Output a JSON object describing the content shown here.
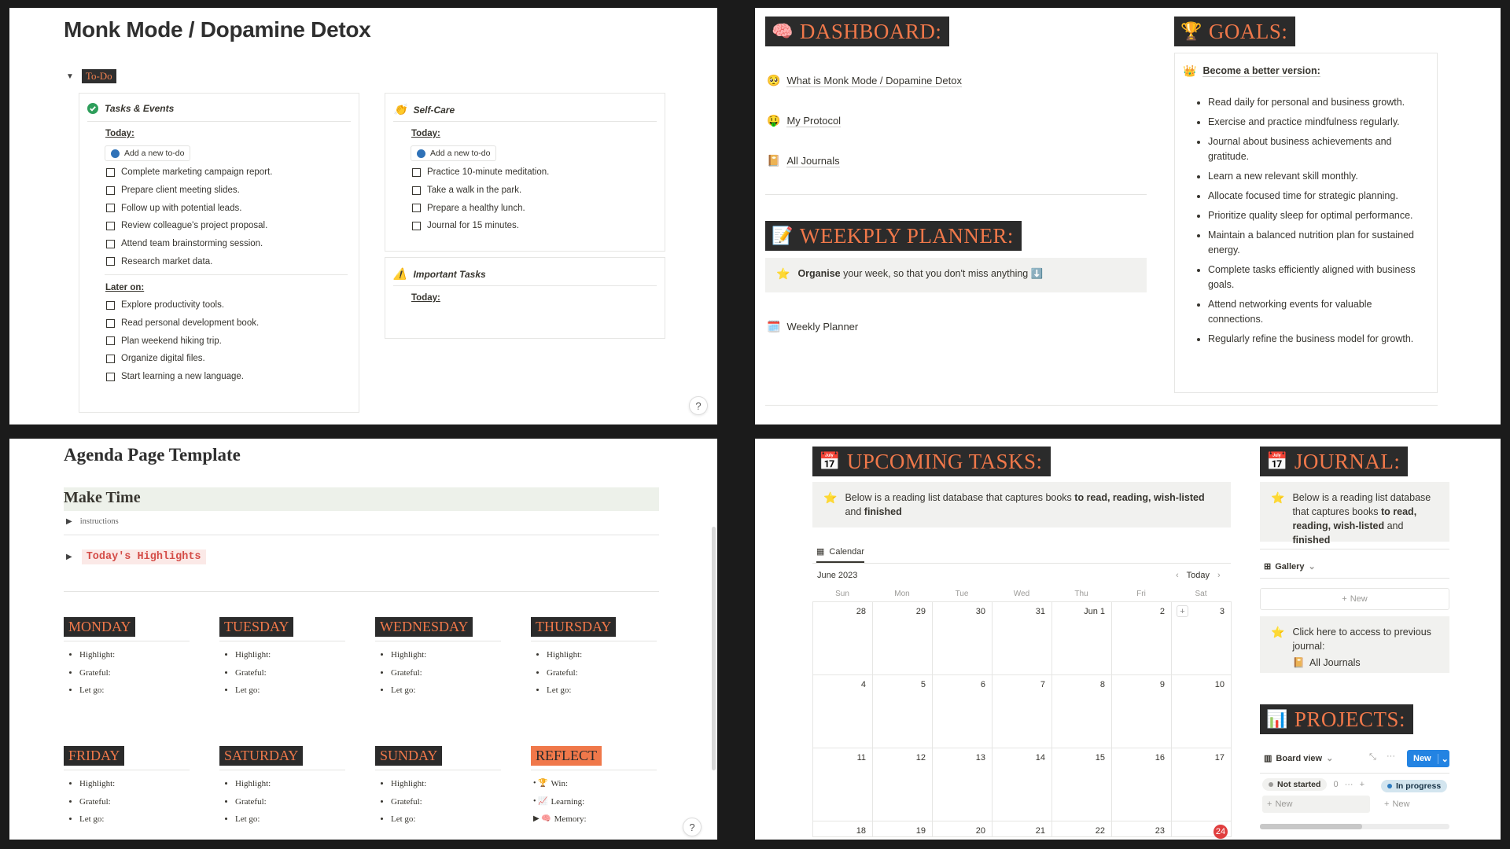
{
  "monk": {
    "title": "Monk Mode / Dopamine Detox",
    "todo_tag": "To-Do",
    "tasks_card": {
      "title": "Tasks & Events",
      "today_label": "Today:",
      "add_label": "Add a new to-do",
      "today_items": [
        "Complete marketing campaign report.",
        "Prepare client meeting slides.",
        "Follow up with potential leads.",
        "Review colleague's project proposal.",
        "Attend team brainstorming session.",
        "Research market data."
      ],
      "later_label": "Later on:",
      "later_items": [
        "Explore productivity tools.",
        "Read personal development book.",
        "Plan weekend hiking trip.",
        "Organize digital files.",
        "Start learning a new language."
      ]
    },
    "selfcare_card": {
      "title": "Self-Care",
      "today_label": "Today:",
      "add_label": "Add a new to-do",
      "items": [
        "Practice 10-minute meditation.",
        "Take a walk in the park.",
        "Prepare a healthy lunch.",
        "Journal for 15 minutes."
      ]
    },
    "important_card": {
      "title": "Important Tasks",
      "today_label": "Today:"
    },
    "help": "?"
  },
  "dashboard": {
    "banner": "DASHBOARD:",
    "links": [
      "What is Monk Mode / Dopamine Detox",
      "My Protocol",
      "All Journals"
    ],
    "planner_banner": "WEEKPLY PLANNER:",
    "planner_callout_bold": "Organise",
    "planner_callout_rest": " your week, so that you don't miss anything",
    "planner_link": "Weekly Planner",
    "goals_banner": "GOALS:",
    "goals_heading": "Become a better version:",
    "goals": [
      "Read daily for personal and business growth.",
      "Exercise and practice mindfulness regularly.",
      "Journal about business achievements and gratitude.",
      "Learn a new relevant skill monthly.",
      "Allocate focused time for strategic planning.",
      "Prioritize quality sleep for optimal performance.",
      "Maintain a balanced nutrition plan for sustained energy.",
      "Complete tasks efficiently aligned with business goals.",
      "Attend networking events for valuable connections.",
      "Regularly refine the business model for growth."
    ]
  },
  "agenda": {
    "title": "Agenda Page Template",
    "make_time": "Make Time",
    "instructions": "instructions",
    "highlights": "Today's Highlights",
    "days": [
      {
        "name": "MONDAY",
        "items": [
          "Highlight:",
          "Grateful:",
          "Let go:"
        ]
      },
      {
        "name": "TUESDAY",
        "items": [
          "Highlight:",
          "Grateful:",
          "Let go:"
        ]
      },
      {
        "name": "WEDNESDAY",
        "items": [
          "Highlight:",
          "Grateful:",
          "Let go:"
        ]
      },
      {
        "name": "THURSDAY",
        "items": [
          "Highlight:",
          "Grateful:",
          "Let go:"
        ]
      },
      {
        "name": "FRIDAY",
        "items": [
          "Highlight:",
          "Grateful:",
          "Let go:"
        ]
      },
      {
        "name": "SATURDAY",
        "items": [
          "Highlight:",
          "Grateful:",
          "Let go:"
        ]
      },
      {
        "name": "SUNDAY",
        "items": [
          "Highlight:",
          "Grateful:",
          "Let go:"
        ]
      }
    ],
    "reflect": {
      "name": "REFLECT",
      "items": [
        "Win:",
        "Learning:",
        "Memory:"
      ]
    },
    "help": "?"
  },
  "upcoming": {
    "banner": "UPCOMING TASKS:",
    "callout_pre": "Below is a reading list database that captures books ",
    "callout_bold1": "to read, reading, wish-listed",
    "callout_mid": " and ",
    "callout_bold2": "finished",
    "tab": "Calendar",
    "month": "June 2023",
    "today_btn": "Today",
    "dows": [
      "Sun",
      "Mon",
      "Tue",
      "Wed",
      "Thu",
      "Fri",
      "Sat"
    ],
    "weeks": [
      [
        "28",
        "29",
        "30",
        "31",
        "Jun 1",
        "2",
        "3"
      ],
      [
        "4",
        "5",
        "6",
        "7",
        "8",
        "9",
        "10"
      ],
      [
        "11",
        "12",
        "13",
        "14",
        "15",
        "16",
        "17"
      ],
      [
        "18",
        "19",
        "20",
        "21",
        "22",
        "23",
        "24"
      ]
    ],
    "today": "24"
  },
  "journal": {
    "banner": "JOURNAL:",
    "callout_pre": "Below is a reading list database that captures books ",
    "callout_bold1": "to read, reading, wish-listed",
    "callout_mid": " and ",
    "callout_bold2": "finished",
    "view": "Gallery",
    "new_label": "New",
    "access_text": "Click here to access to previous journal:",
    "access_link": "All Journals"
  },
  "projects": {
    "banner": "PROJECTS:",
    "view": "Board view",
    "new_btn": "New",
    "col1": "Not started",
    "col1_count": "0",
    "col2": "In progress",
    "new_label": "New"
  },
  "colors": {
    "banner_bg": "#2b2b2b",
    "banner_text": "#f0784a",
    "accent_blue": "#2383e2",
    "today_red": "#e03e3e"
  }
}
